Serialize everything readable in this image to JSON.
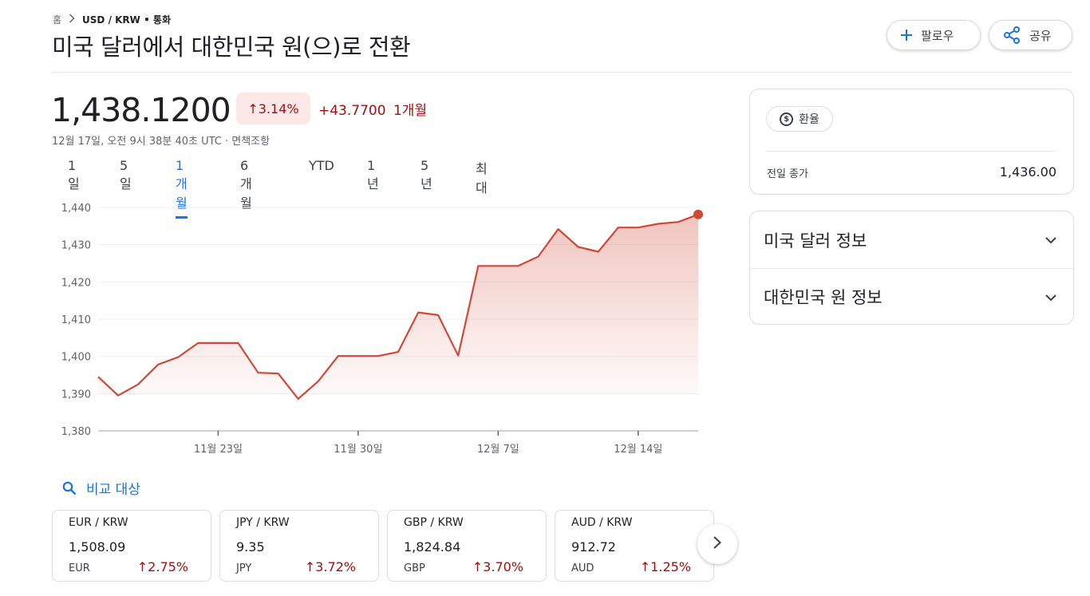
{
  "breadcrumb": {
    "home": "홈",
    "current": "USD / KRW • 통화"
  },
  "title": "미국 달러에서 대한민국 원(으)로 전환",
  "actions": {
    "follow_label": "팔로우",
    "share_label": "공유"
  },
  "quote": {
    "price": "1,438.1200",
    "change_pct": "↑3.14%",
    "change_abs": "+43.7700",
    "change_period": "1개월",
    "timestamp": "12월 17일, 오전 9시 38분 40초 UTC · 면책조항"
  },
  "range_tabs": [
    {
      "label": "1일",
      "active": false
    },
    {
      "label": "5일",
      "active": false
    },
    {
      "label": "1개월",
      "active": true
    },
    {
      "label": "6개월",
      "active": false
    },
    {
      "label": "YTD",
      "active": false
    },
    {
      "label": "1년",
      "active": false
    },
    {
      "label": "5년",
      "active": false
    },
    {
      "label": "최대",
      "active": false
    }
  ],
  "chart_data": {
    "type": "area",
    "title": "",
    "xlabel": "",
    "ylabel": "",
    "y_ticks": [
      "1,380",
      "1,390",
      "1,400",
      "1,410",
      "1,420",
      "1,430",
      "1,440"
    ],
    "x_ticks": [
      "11월 23일",
      "11월 30일",
      "12월 7일",
      "12월 14일"
    ],
    "ylim": [
      1380,
      1440
    ],
    "x": [
      "11월 17일",
      "11월 18일",
      "11월 19일",
      "11월 20일",
      "11월 21일",
      "11월 22일",
      "11월 23일",
      "11월 24일",
      "11월 25일",
      "11월 26일",
      "11월 27일",
      "11월 28일",
      "11월 29일",
      "11월 30일",
      "12월 1일",
      "12월 2일",
      "12월 3일",
      "12월 4일",
      "12월 5일",
      "12월 6일",
      "12월 7일",
      "12월 8일",
      "12월 9일",
      "12월 10일",
      "12월 11일",
      "12월 12일",
      "12월 13일",
      "12월 14일",
      "12월 15일",
      "12월 16일",
      "12월 17일"
    ],
    "values": [
      1394.5,
      1389.5,
      1392.5,
      1397.8,
      1399.8,
      1403.6,
      1403.6,
      1403.6,
      1395.6,
      1395.4,
      1388.6,
      1393.3,
      1400.1,
      1400.1,
      1400.1,
      1401.2,
      1411.8,
      1411.1,
      1400.2,
      1424.3,
      1424.3,
      1424.3,
      1426.8,
      1434.2,
      1429.4,
      1428.1,
      1434.6,
      1434.6,
      1435.6,
      1436.1,
      1438.12
    ],
    "grid": true,
    "line_color": "#d14836",
    "fill_color": "#d14836"
  },
  "compare": {
    "label": "비교 대상"
  },
  "compare_cards": [
    {
      "pair": "EUR / KRW",
      "value": "1,508.09",
      "currency": "EUR",
      "change": "↑2.75%"
    },
    {
      "pair": "JPY / KRW",
      "value": "9.35",
      "currency": "JPY",
      "change": "↑3.72%"
    },
    {
      "pair": "GBP / KRW",
      "value": "1,824.84",
      "currency": "GBP",
      "change": "↑3.70%"
    },
    {
      "pair": "AUD / KRW",
      "value": "912.72",
      "currency": "AUD",
      "change": "↑1.25%"
    }
  ],
  "rate_card": {
    "chip_label": "환율",
    "coin_symbol": "$",
    "prev_close_label": "전일 종가",
    "prev_close_value": "1,436.00"
  },
  "info_rows": [
    {
      "label": "미국 달러 정보"
    },
    {
      "label": "대한민국 원 정보"
    }
  ],
  "colors": {
    "accent": "#1a73e8",
    "negative_text": "#a50e0e",
    "negative_bg": "#fce8e6",
    "chart_line": "#d14836"
  }
}
